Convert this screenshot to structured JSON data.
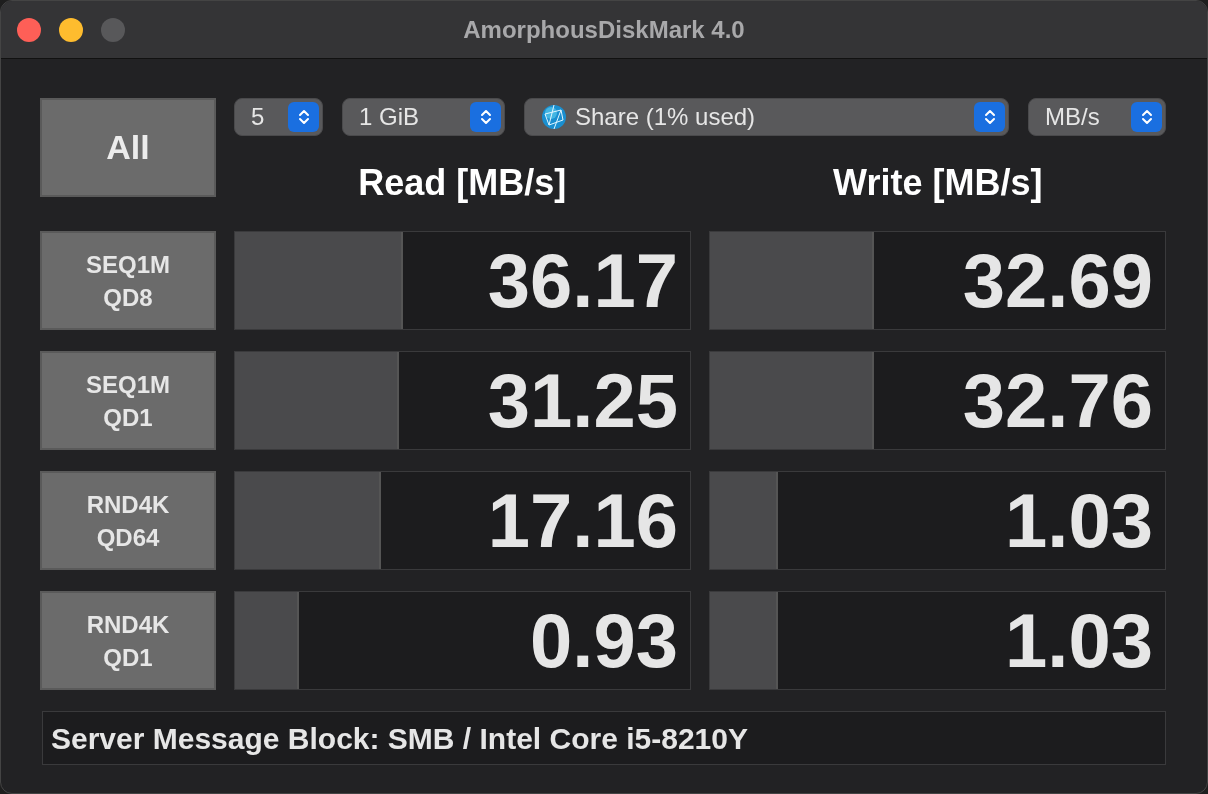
{
  "window": {
    "title": "AmorphousDiskMark 4.0"
  },
  "all_button": "All",
  "selectors": [
    {
      "kind": "plain",
      "value": "5"
    },
    {
      "kind": "plain",
      "value": "1 GiB"
    },
    {
      "kind": "drive",
      "value": "Share (1% used)"
    },
    {
      "kind": "plain",
      "value": "MB/s"
    }
  ],
  "columns": [
    "Read [MB/s]",
    "Write [MB/s]"
  ],
  "rows": [
    {
      "label": [
        "SEQ1M",
        "QD8"
      ],
      "read": {
        "value": "36.17",
        "level": 0.37
      },
      "write": {
        "value": "32.69",
        "level": 0.36
      }
    },
    {
      "label": [
        "SEQ1M",
        "QD1"
      ],
      "read": {
        "value": "31.25",
        "level": 0.36
      },
      "write": {
        "value": "32.76",
        "level": 0.36
      }
    },
    {
      "label": [
        "RND4K",
        "QD64"
      ],
      "read": {
        "value": "17.16",
        "level": 0.32
      },
      "write": {
        "value": "1.03",
        "level": 0.15
      }
    },
    {
      "label": [
        "RND4K",
        "QD1"
      ],
      "read": {
        "value": "0.93",
        "level": 0.14
      },
      "write": {
        "value": "1.03",
        "level": 0.15
      }
    }
  ],
  "status_bar": "Server Message Block: SMB / Intel Core i5-8210Y"
}
